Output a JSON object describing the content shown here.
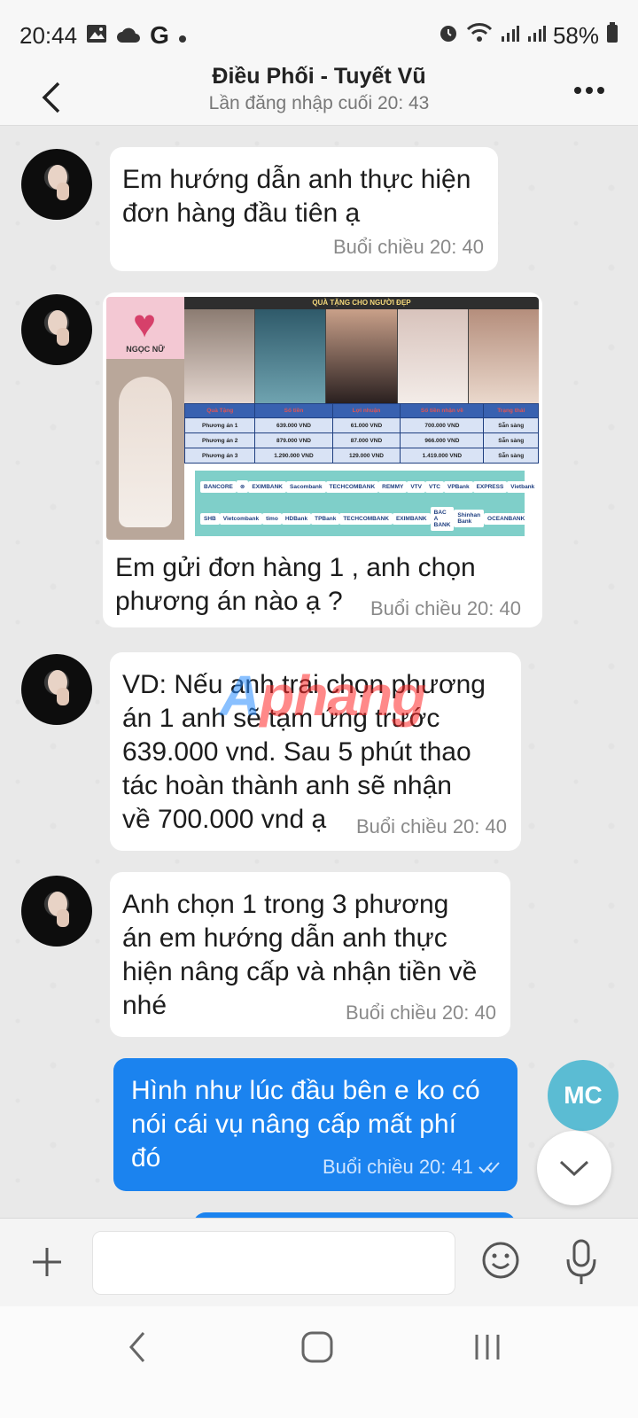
{
  "status_bar": {
    "time": "20:44",
    "battery": "58%",
    "left_icons": [
      "image-icon",
      "cloud-icon",
      "google-g-icon",
      "dot-icon"
    ],
    "right_icons": [
      "alarm-icon",
      "wifi-icon",
      "signal-icon",
      "signal-icon",
      "battery-icon"
    ]
  },
  "header": {
    "title": "Điều Phối - Tuyết Vũ",
    "subtitle": "Lần đăng nhập cuối 20: 43"
  },
  "messages": [
    {
      "text": "Em hướng dẫn anh thực hiện\nđơn hàng đầu tiên ạ",
      "time": "Buổi chiều  20: 40"
    },
    {
      "text": "Em gửi đơn hàng 1 , anh chọn\nphương án nào ạ ?",
      "time": "Buổi chiều  20: 40"
    },
    {
      "text": "VD: Nếu anh trai chọn phương\nán 1 anh sẽ tạm ứng trước\n639.000 vnd. Sau 5 phút thao\ntác hoàn thành anh sẽ nhận\nvề 700.000 vnd ạ",
      "time": "Buổi chiều  20: 40"
    },
    {
      "text": "Anh chọn 1 trong 3 phương\nán em hướng dẫn anh thực\nhiện nâng cấp và nhận tiền về\nnhé",
      "time": "Buổi chiều  20: 40"
    }
  ],
  "outgoing": {
    "text": "Hình như lúc đầu bên e ko có\nnói cái vụ nâng cấp mất phí\nđó",
    "time": "Buổi chiều  20: 41",
    "sender_initials": "MC"
  },
  "promo_image": {
    "banner": "QUÀ TẶNG CHO NGƯỜI ĐẸP",
    "logo": "NGỌC NỮ",
    "headers": [
      "Quà Tặng",
      "Số tiền",
      "Lợi nhuận",
      "Số tiền nhận về",
      "Trạng thái"
    ],
    "rows": [
      [
        "Phương án 1",
        "639.000 VND",
        "61.000 VND",
        "700.000 VND",
        "Sẵn sàng"
      ],
      [
        "Phương án 2",
        "879.000 VND",
        "87.000 VND",
        "966.000 VND",
        "Sẵn sàng"
      ],
      [
        "Phương án 3",
        "1.290.000 VND",
        "129.000 VND",
        "1.419.000 VND",
        "Sẵn sàng"
      ]
    ],
    "banks_row1": [
      "BANCORE",
      "⊗",
      "EXIMBANK",
      "Sacombank",
      "TECHCOMBANK",
      "REMMY",
      "VTV",
      "VTC",
      "VPBank",
      "EXPRESS",
      "Vietbank"
    ],
    "banks_row2": [
      "SHB",
      "Vietcombank",
      "timo",
      "HDBank",
      "TPBank",
      "TECHCOMBANK",
      "EXIMBANK",
      "BAC A BANK",
      "Shinhan Bank",
      "OCEANBANK"
    ]
  },
  "watermark": {
    "part1": "A",
    "part2": "phang"
  },
  "input": {
    "placeholder": ""
  },
  "colors": {
    "outgoing_bubble": "#1b83ef",
    "mc_avatar": "#5bbcd3"
  }
}
